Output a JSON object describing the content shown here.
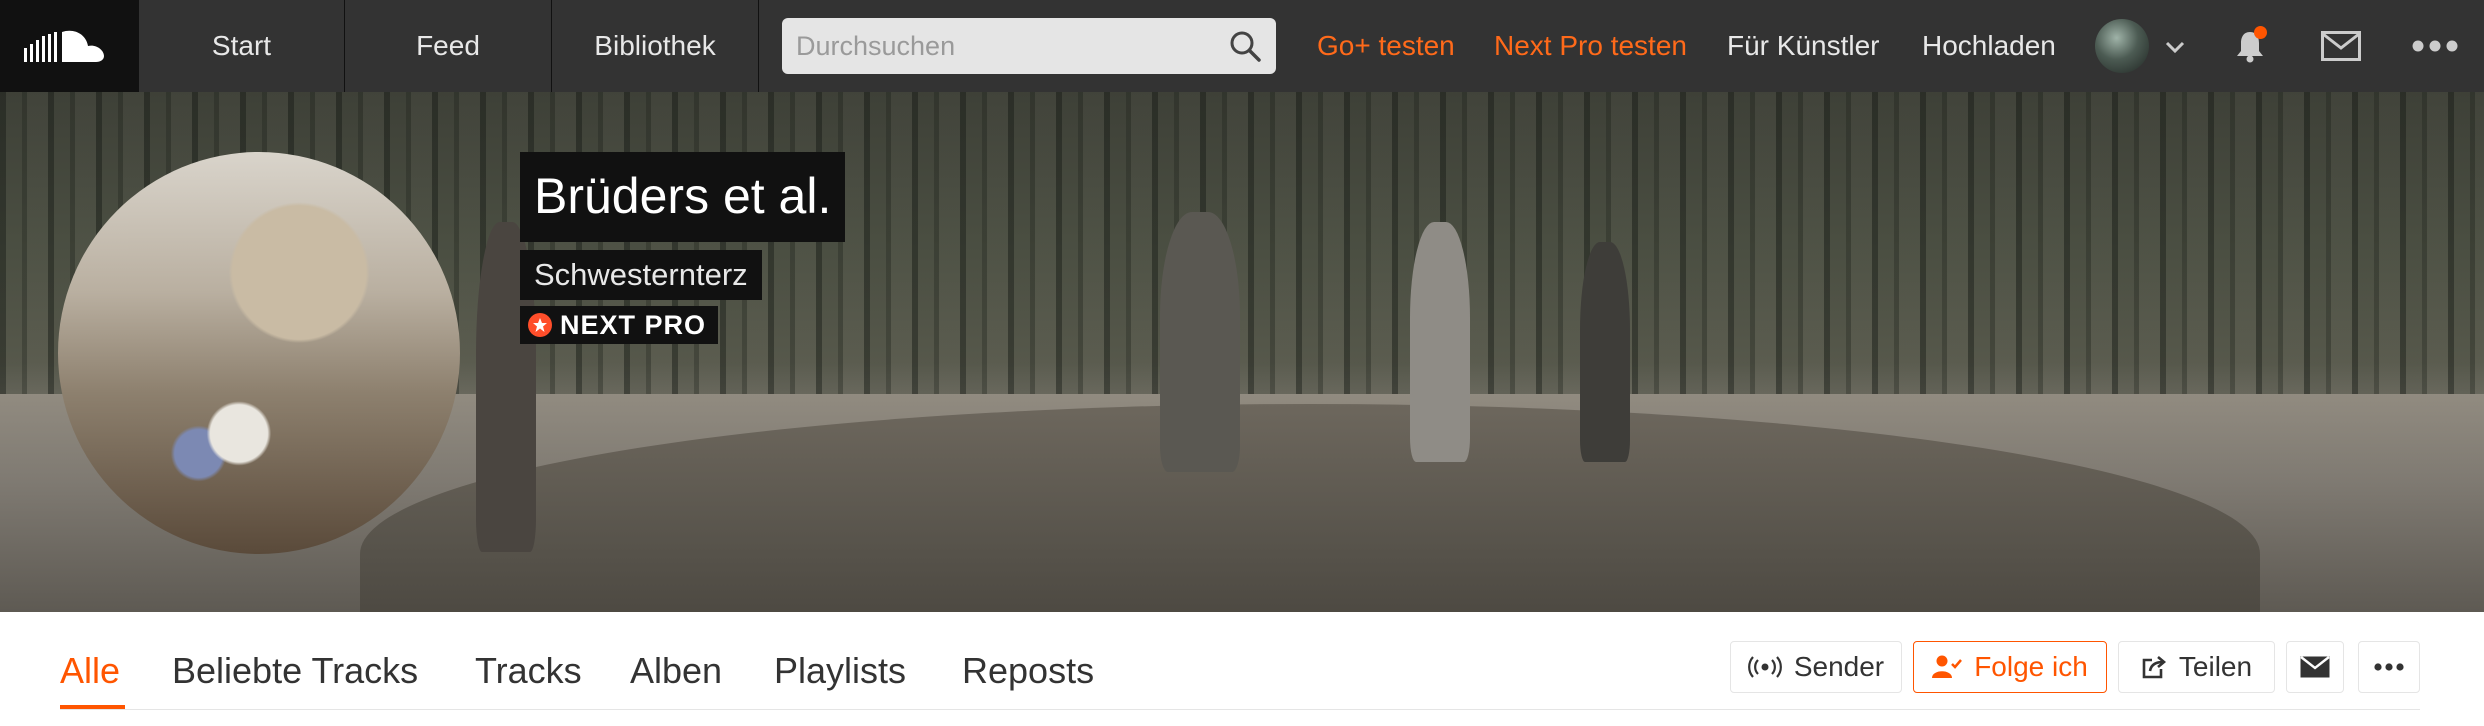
{
  "nav": {
    "logo_icon": "soundcloud-logo-icon",
    "tabs": [
      "Start",
      "Feed",
      "Bibliothek"
    ],
    "search": {
      "placeholder": "Durchsuchen",
      "icon": "search-icon"
    },
    "links": {
      "go_plus": "Go+ testen",
      "next_pro": "Next Pro testen",
      "artists": "Für Künstler",
      "upload": "Hochladen"
    },
    "accent_color": "#ff5500",
    "icons": [
      "user-avatar",
      "chevron-down-icon",
      "bell-icon",
      "mail-icon",
      "more-icon"
    ]
  },
  "profile": {
    "name": "Brüders et al.",
    "subtitle": "Schwesternterz",
    "badge": "NEXT PRO"
  },
  "profile_tabs": {
    "items": [
      "Alle",
      "Beliebte Tracks",
      "Tracks",
      "Alben",
      "Playlists",
      "Reposts"
    ],
    "active": "Alle"
  },
  "actions": {
    "station": "Sender",
    "following": "Folge ich",
    "share": "Teilen"
  }
}
